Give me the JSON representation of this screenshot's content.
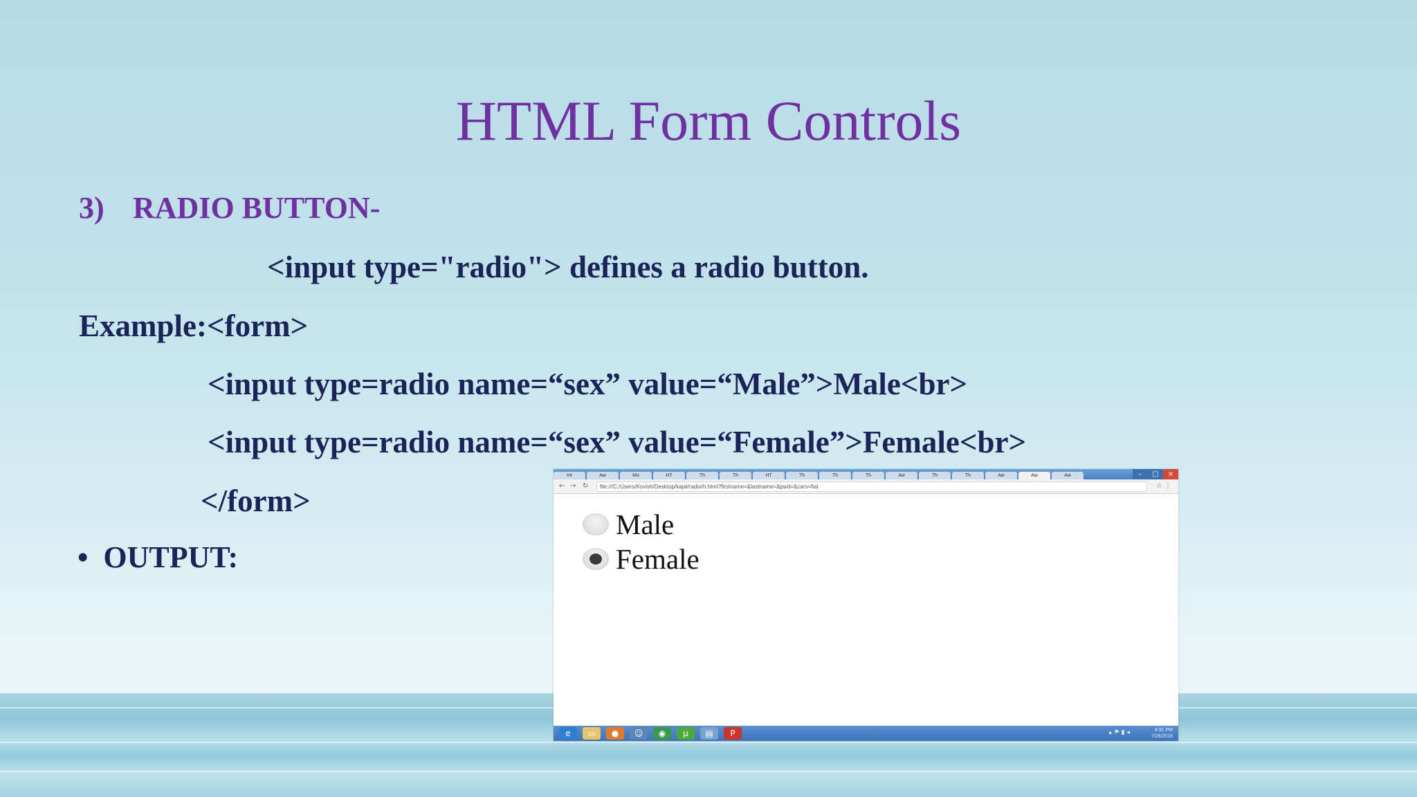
{
  "slide": {
    "title": "HTML Form Controls",
    "heading_number": "3)",
    "heading_text": "RADIO BUTTON-",
    "definition": "<input type=\"radio\"> defines a radio button.",
    "example_line": "Example:<form>",
    "code_line_1": "<input type=radio name=“sex” value=“Male”>Male<br>",
    "code_line_2": "<input type=radio name=“sex” value=“Female”>Female<br>",
    "code_close": "</form>",
    "bullet_symbol": "•",
    "bullet_label": "OUTPUT:"
  },
  "browser": {
    "url": "file:///C:/Users/Kovish/Desktop/kajal/radio/h.html?firstname=&lastname=&pwd=&cars=fiat",
    "tabs": [
      "Int",
      "Aw",
      "Mo",
      "HT",
      "Th",
      "Th",
      "HT",
      "Th",
      "Th",
      "Th",
      "Aw",
      "Th",
      "Th",
      "Aw",
      "Aw",
      "Aw"
    ],
    "active_tab_index": 14,
    "options": [
      {
        "label": "Male",
        "checked": false
      },
      {
        "label": "Female",
        "checked": true
      }
    ],
    "tray_time": "4:31 PM",
    "tray_date": "7/28/2016"
  },
  "colors": {
    "title": "#7030a0",
    "body_text": "#1b2458",
    "background": "#c2e2ea"
  },
  "icons": {
    "back": "back-arrow-icon",
    "forward": "forward-arrow-icon",
    "reload": "reload-icon",
    "taskbar": [
      "internet-explorer-icon",
      "file-explorer-icon",
      "firefox-icon",
      "people-icon",
      "chrome-icon",
      "utorrent-icon",
      "notepad-icon",
      "powerpoint-icon"
    ]
  }
}
